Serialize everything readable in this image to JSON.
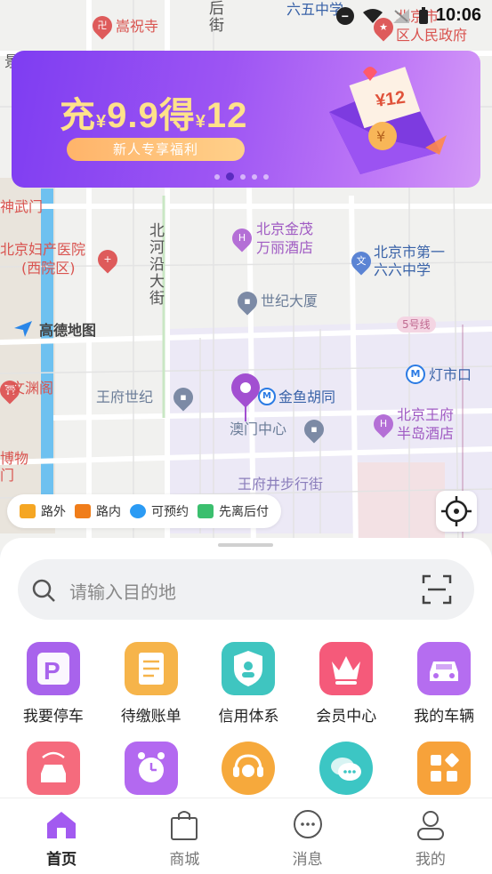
{
  "status_bar": {
    "time": "10:06"
  },
  "banner": {
    "title_pre": "充",
    "currency1": "¥",
    "amount1": "9.9",
    "title_mid": "得",
    "currency2": "¥",
    "amount2": "12",
    "subtitle": "新人专享福利",
    "gift_label": "¥12",
    "slide_count": 5,
    "active_slide": 2
  },
  "map": {
    "logo": "高德地图",
    "pois": {
      "chongzhusi": "嵩祝寺",
      "hou_jie": "后街",
      "liuwu_school": "六五中学",
      "people_gov": "北京市\n区人民政府",
      "jing": "景",
      "shen_wu_men": "神武门",
      "fuchan": "北京妇产医院",
      "fuchan2": "(西院区)",
      "jinmao": "北京金茂",
      "jinmao2": "万丽酒店",
      "school166": "北京市第一",
      "school166b": "六六中学",
      "beiheyan": "北河沿大街",
      "shiji": "世纪大厦",
      "line5": "5号线",
      "dengshikou": "灯市口",
      "wenyuange": "文渊阁",
      "wangfu_shiji": "王府世纪",
      "jinyu": "金鱼胡同",
      "peninsula": "北京王府",
      "peninsula2": "半岛酒店",
      "aomen": "澳门中心",
      "bowu": "博物",
      "men": "门",
      "wangfujing": "王府井步行街",
      "dong": "东",
      "jie": "街",
      "sheng": "圣",
      "dong2": "东",
      "qu": "区"
    }
  },
  "legend": [
    {
      "label": "路外",
      "color": "#f5a623"
    },
    {
      "label": "路内",
      "color": "#f07d1a"
    },
    {
      "label": "可预约",
      "color": "#2b9bf4"
    },
    {
      "label": "先离后付",
      "color": "#3bbf6e"
    }
  ],
  "search": {
    "placeholder": "请输入目的地"
  },
  "services_row1": [
    {
      "label": "我要停车",
      "icon": "parking-icon",
      "color": "#a863ec"
    },
    {
      "label": "待缴账单",
      "icon": "bill-icon",
      "color": "#f6b44a"
    },
    {
      "label": "信用体系",
      "icon": "credit-shield-icon",
      "color": "#3fc5c0"
    },
    {
      "label": "会员中心",
      "icon": "crown-icon",
      "color": "#f55a7a"
    },
    {
      "label": "我的车辆",
      "icon": "car-icon",
      "color": "#b56df0"
    }
  ],
  "services_row2": [
    {
      "icon": "car-route-icon",
      "color": "#f56b7d"
    },
    {
      "icon": "alarm-clock-icon",
      "color": "#b369f0"
    },
    {
      "icon": "customer-service-icon",
      "color": "#f6a93c"
    },
    {
      "icon": "chat-bubbles-icon",
      "color": "#3cc6c4"
    },
    {
      "icon": "apps-grid-icon",
      "color": "#f7a23a"
    }
  ],
  "tabs": [
    {
      "label": "首页",
      "icon": "home-icon",
      "active": true
    },
    {
      "label": "商城",
      "icon": "shopping-bag-icon",
      "active": false
    },
    {
      "label": "消息",
      "icon": "message-icon",
      "active": false
    },
    {
      "label": "我的",
      "icon": "profile-icon",
      "active": false
    }
  ]
}
